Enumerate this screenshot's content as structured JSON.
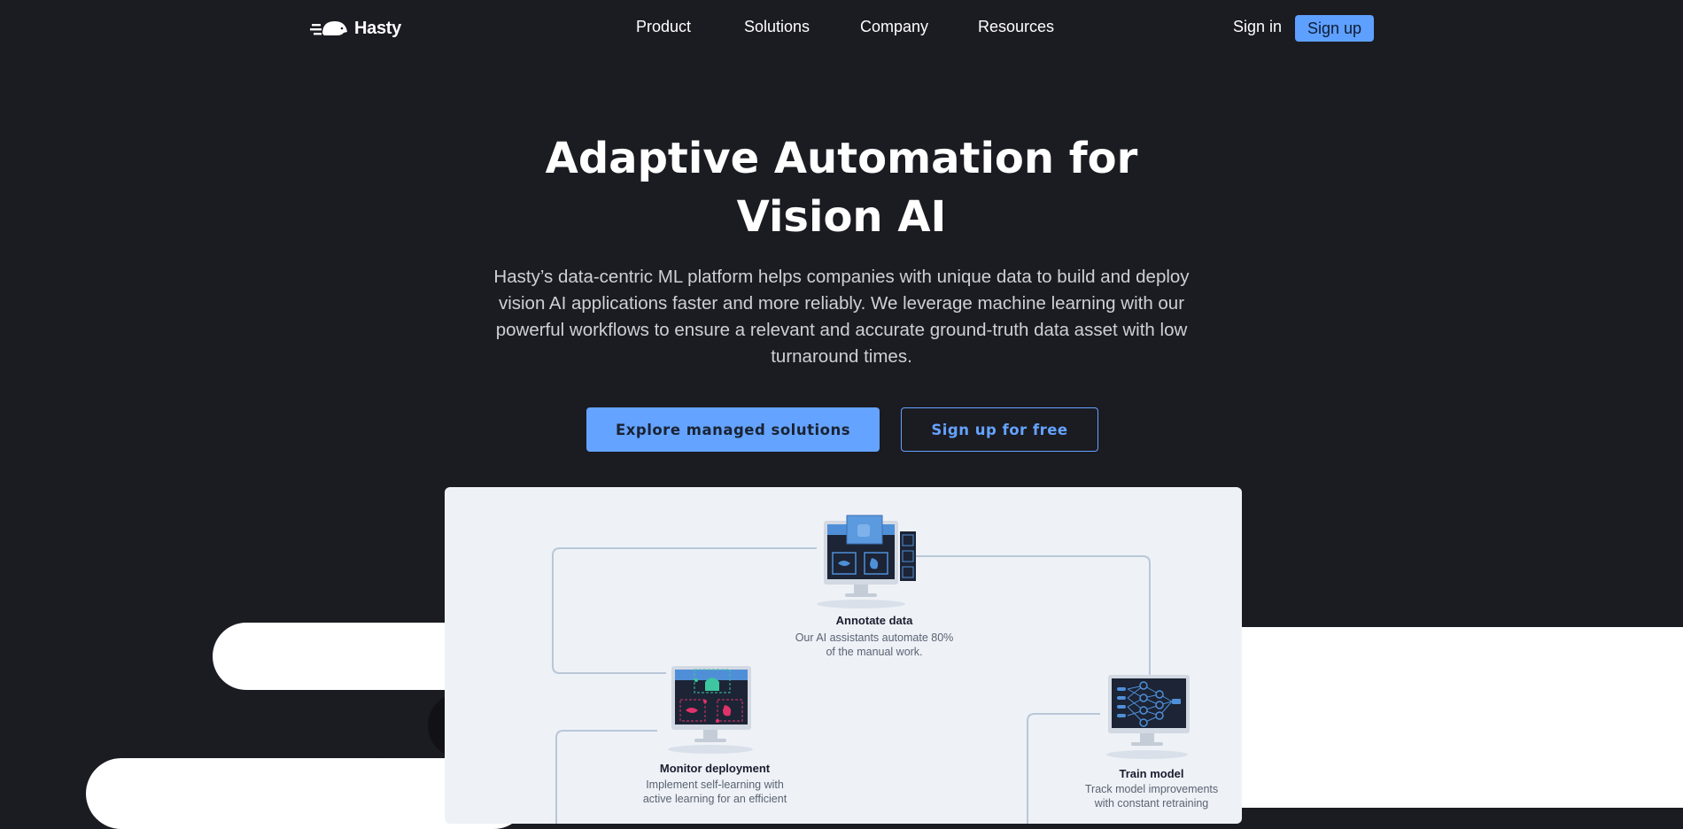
{
  "nav": {
    "logo_text": "Hasty",
    "items": [
      {
        "label": "Product"
      },
      {
        "label": "Solutions"
      },
      {
        "label": "Company"
      },
      {
        "label": "Resources"
      }
    ],
    "sign_in": "Sign in",
    "sign_up": "Sign up"
  },
  "hero": {
    "title_line1": "Adaptive Automation for",
    "title_line2": "Vision AI",
    "description": "Hasty’s data-centric ML platform helps companies with unique data to build and deploy vision AI applications faster and more reliably. We leverage machine learning with our powerful workflows to ensure a relevant and accurate ground-truth data asset with low turnaround times.",
    "cta_primary": "Explore managed solutions",
    "cta_secondary": "Sign up for free"
  },
  "diagram": {
    "annotate": {
      "title": "Annotate data",
      "desc_line1": "Our AI assistants automate 80%",
      "desc_line2": "of the manual work."
    },
    "monitor": {
      "title": "Monitor deployment",
      "desc_line1": "Implement self-learning with",
      "desc_line2": "active learning for an efficient"
    },
    "train": {
      "title": "Train model",
      "desc_line1": "Track model improvements",
      "desc_line2": "with constant retraining"
    }
  },
  "colors": {
    "background": "#1b1b22",
    "accent": "#64a3ff",
    "card": "#eef2f7"
  }
}
